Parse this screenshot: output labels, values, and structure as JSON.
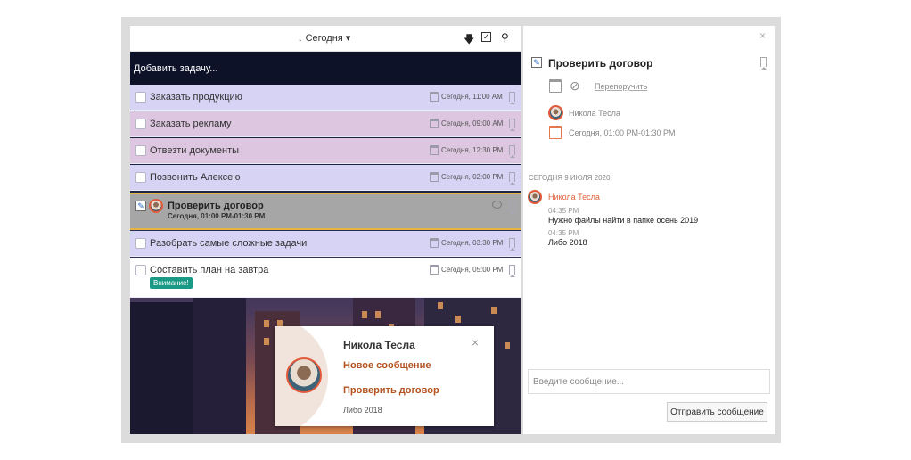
{
  "toolbar": {
    "sort_label": "Сегодня",
    "sort_arrow": "↓",
    "sort_dropdown": "▾",
    "download_icon": "download-icon",
    "check_icon": "check-icon",
    "search_icon": "search-icon"
  },
  "add_task": {
    "placeholder": "Добавить задачу..."
  },
  "tasks": [
    {
      "title": "Заказать продукцию",
      "date": "Сегодня, 11:00 AM",
      "color": "#d6d3f5"
    },
    {
      "title": "Заказать рекламу",
      "date": "Сегодня, 09:00 AM",
      "color": "#ddc6df"
    },
    {
      "title": "Отвезти документы",
      "date": "Сегодня, 12:30 PM",
      "color": "#ddc6df"
    },
    {
      "title": "Позвонить Алексею",
      "date": "Сегодня, 02:00 PM",
      "color": "#d6d3f5"
    },
    {
      "title": "Проверить договор",
      "subtitle": "Сегодня, 01:00 PM-01:30 PM",
      "selected": true
    },
    {
      "title": "Разобрать самые сложные задачи",
      "date": "Сегодня, 03:30 PM",
      "color": "#d6d3f5"
    },
    {
      "title": "Составить план на завтра",
      "date": "Сегодня, 05:00 PM",
      "badge": "Внимание!",
      "color": "#ffffff"
    }
  ],
  "notification": {
    "name": "Никола Тесла",
    "close": "×",
    "message_label": "Новое сообщение",
    "task": "Проверить договор",
    "text": "Либо 2018"
  },
  "detail": {
    "close": "×",
    "title": "Проверить договор",
    "reassign": "Перепоручить",
    "assignee": "Никола Тесла",
    "time": "Сегодня, 01:00 PM-01:30 PM",
    "day_separator": "СЕГОДНЯ 9 ИЮЛЯ 2020",
    "comment_author": "Никола Тесла",
    "comments": [
      {
        "time": "04:35 PM",
        "text": "Нужно файлы найти в папке осень 2019"
      },
      {
        "time": "04:35 PM",
        "text": "Либо 2018"
      }
    ],
    "input_placeholder": "Введите сообщение...",
    "send_label": "Отправить сообщение"
  }
}
